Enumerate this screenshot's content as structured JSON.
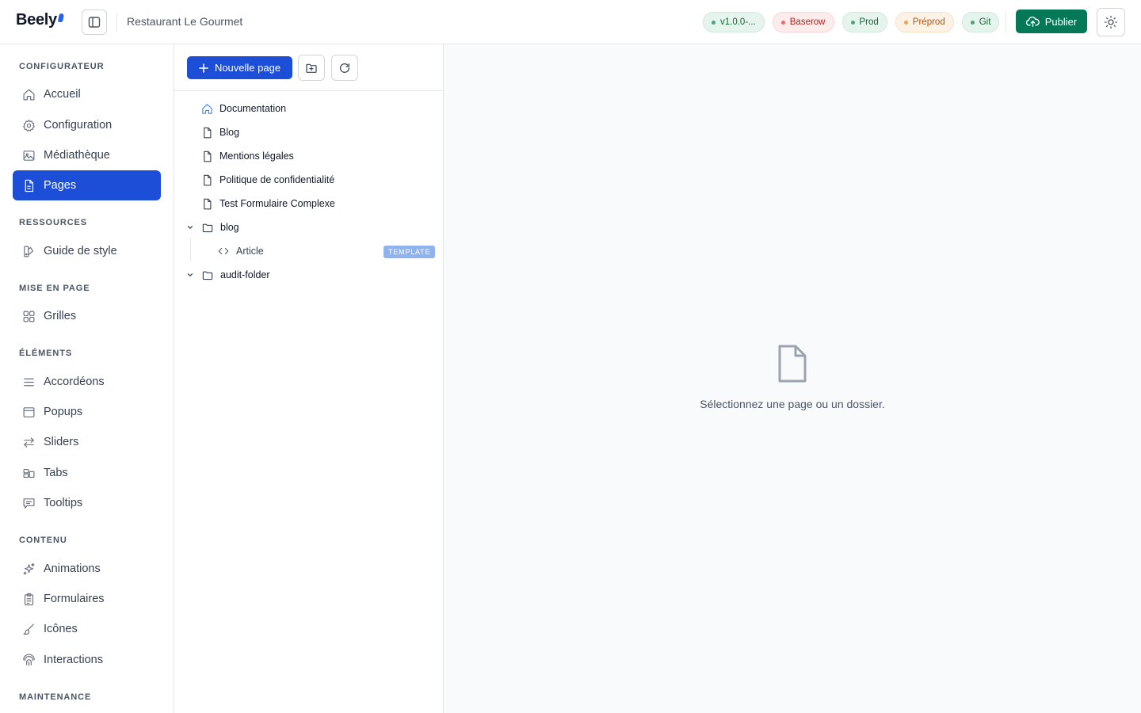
{
  "header": {
    "logo": "Beely",
    "project_name": "Restaurant Le Gourmet",
    "badges": [
      {
        "label": "v1.0.0-...",
        "color": "green"
      },
      {
        "label": "Baserow",
        "color": "red"
      },
      {
        "label": "Prod",
        "color": "green"
      },
      {
        "label": "Préprod",
        "color": "orange"
      },
      {
        "label": "Git",
        "color": "green"
      }
    ],
    "publish_label": "Publier"
  },
  "sidebar": {
    "sections": [
      {
        "title": "CONFIGURATEUR",
        "items": [
          {
            "label": "Accueil",
            "icon": "home-icon"
          },
          {
            "label": "Configuration",
            "icon": "gear-icon"
          },
          {
            "label": "Médiathèque",
            "icon": "image-icon"
          },
          {
            "label": "Pages",
            "icon": "file-icon",
            "active": true
          }
        ]
      },
      {
        "title": "RESSOURCES",
        "items": [
          {
            "label": "Guide de style",
            "icon": "palette-icon"
          }
        ]
      },
      {
        "title": "MISE EN PAGE",
        "items": [
          {
            "label": "Grilles",
            "icon": "grid-icon"
          }
        ]
      },
      {
        "title": "ÉLÉMENTS",
        "items": [
          {
            "label": "Accordéons",
            "icon": "menu-lines-icon"
          },
          {
            "label": "Popups",
            "icon": "window-icon"
          },
          {
            "label": "Sliders",
            "icon": "arrows-swap-icon"
          },
          {
            "label": "Tabs",
            "icon": "tabs-icon"
          },
          {
            "label": "Tooltips",
            "icon": "message-icon"
          }
        ]
      },
      {
        "title": "CONTENU",
        "items": [
          {
            "label": "Animations",
            "icon": "sparkles-icon"
          },
          {
            "label": "Formulaires",
            "icon": "clipboard-icon"
          },
          {
            "label": "Icônes",
            "icon": "brush-icon"
          },
          {
            "label": "Interactions",
            "icon": "pointer-icon"
          }
        ]
      },
      {
        "title": "MAINTENANCE",
        "items": []
      }
    ]
  },
  "tree": {
    "new_page_label": "Nouvelle page",
    "items": [
      {
        "label": "Documentation",
        "icon": "home-icon",
        "type": "home"
      },
      {
        "label": "Blog",
        "icon": "file-icon",
        "type": "page"
      },
      {
        "label": "Mentions légales",
        "icon": "file-icon",
        "type": "page"
      },
      {
        "label": "Politique de confidentialité",
        "icon": "file-icon",
        "type": "page"
      },
      {
        "label": "Test Formulaire Complexe",
        "icon": "file-icon",
        "type": "page"
      },
      {
        "label": "blog",
        "icon": "folder-icon",
        "type": "folder"
      },
      {
        "label": "Article",
        "icon": "code-icon",
        "type": "template",
        "tag": "TEMPLATE"
      },
      {
        "label": "audit-folder",
        "icon": "folder-icon",
        "type": "folder"
      }
    ]
  },
  "main": {
    "empty_message": "Sélectionnez une page ou un dossier."
  },
  "colors": {
    "accent": "#1d4ed8",
    "publish": "#047857",
    "template_tag": "#8fb3ee"
  }
}
